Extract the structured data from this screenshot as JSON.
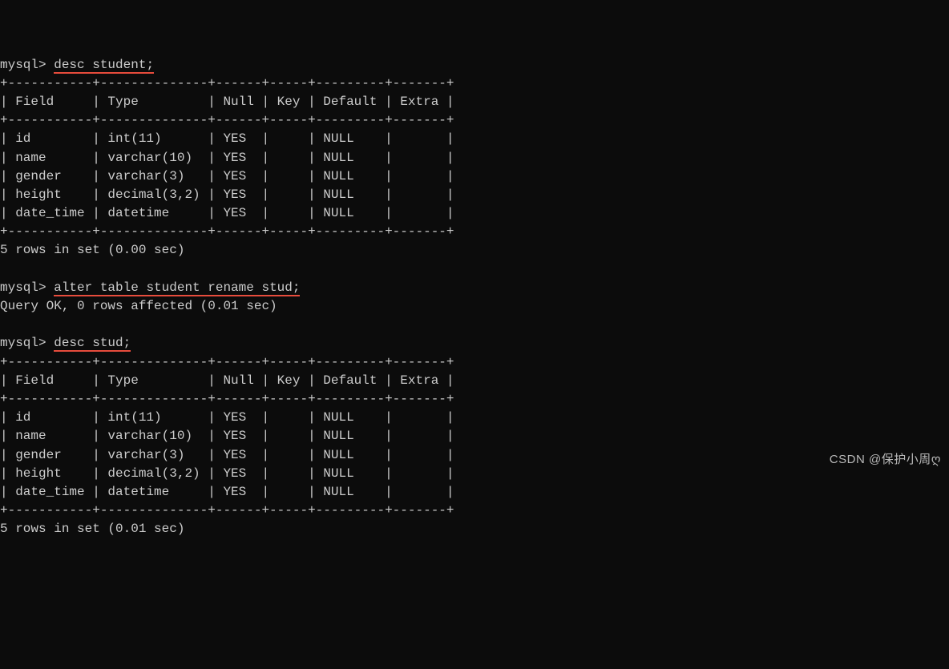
{
  "prompt": "mysql>",
  "cmd1": "desc student;",
  "cmd2": "alter table student rename stud;",
  "cmd3": "desc stud;",
  "query_ok": "Query OK, 0 rows affected (0.01 sec)",
  "rows_msg1": "5 rows in set (0.00 sec)",
  "rows_msg2": "5 rows in set (0.01 sec)",
  "table1": {
    "border_top": "+-----------+--------------+------+-----+---------+-------+",
    "header": "| Field     | Type         | Null | Key | Default | Extra |",
    "border_mid": "+-----------+--------------+------+-----+---------+-------+",
    "rows": [
      "| id        | int(11)      | YES  |     | NULL    |       |",
      "| name      | varchar(10)  | YES  |     | NULL    |       |",
      "| gender    | varchar(3)   | YES  |     | NULL    |       |",
      "| height    | decimal(3,2) | YES  |     | NULL    |       |",
      "| date_time | datetime     | YES  |     | NULL    |       |"
    ],
    "border_bot": "+-----------+--------------+------+-----+---------+-------+"
  },
  "table2": {
    "border_top": "+-----------+--------------+------+-----+---------+-------+",
    "header": "| Field     | Type         | Null | Key | Default | Extra |",
    "border_mid": "+-----------+--------------+------+-----+---------+-------+",
    "rows": [
      "| id        | int(11)      | YES  |     | NULL    |       |",
      "| name      | varchar(10)  | YES  |     | NULL    |       |",
      "| gender    | varchar(3)   | YES  |     | NULL    |       |",
      "| height    | decimal(3,2) | YES  |     | NULL    |       |",
      "| date_time | datetime     | YES  |     | NULL    |       |"
    ],
    "border_bot": "+-----------+--------------+------+-----+---------+-------+"
  },
  "watermark": "CSDN @保护小周ღ"
}
